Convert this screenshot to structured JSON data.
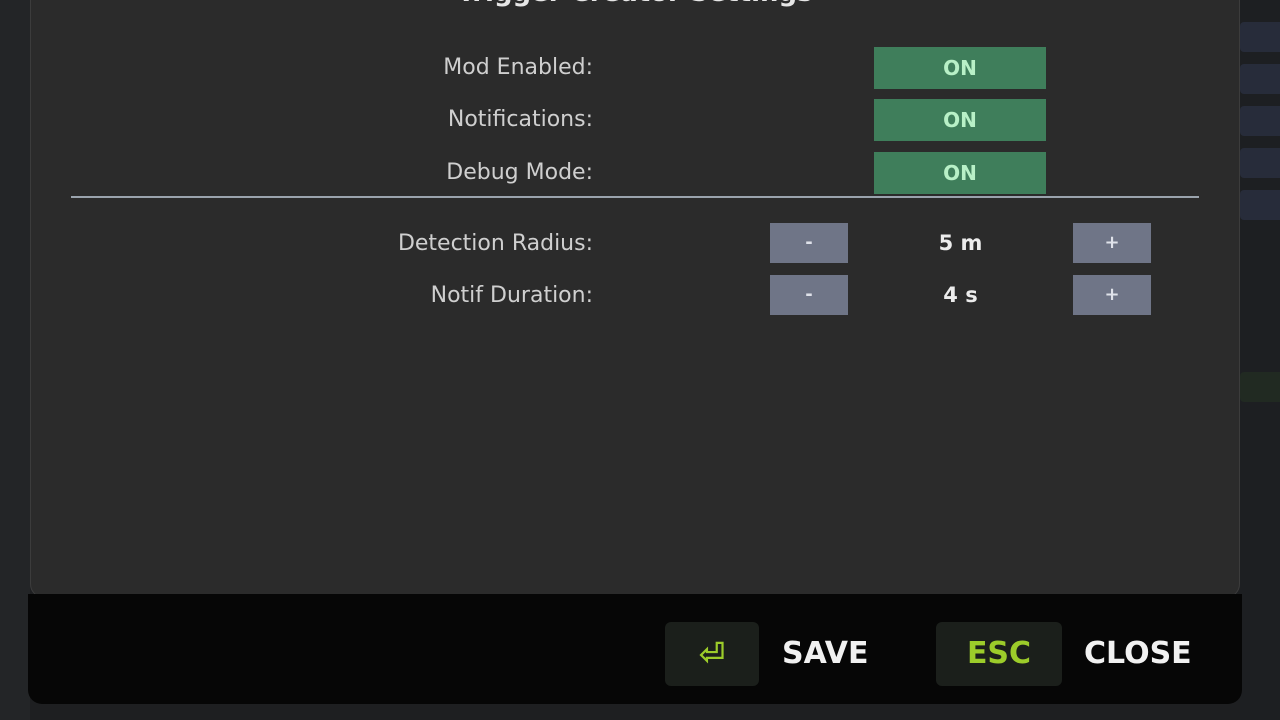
{
  "modal": {
    "title": "Trigger Creator Settings"
  },
  "toggles": [
    {
      "label": "Mod Enabled:",
      "value": "ON"
    },
    {
      "label": "Notifications:",
      "value": "ON"
    },
    {
      "label": "Debug Mode:",
      "value": "ON"
    }
  ],
  "steppers": [
    {
      "label": "Detection Radius:",
      "minus": "-",
      "value": "5 m",
      "plus": "+"
    },
    {
      "label": "Notif Duration:",
      "minus": "-",
      "value": "4 s",
      "plus": "+"
    }
  ],
  "footer": {
    "save_key": "⏎",
    "save_label": "SAVE",
    "close_key": "ESC",
    "close_label": "CLOSE"
  },
  "colors": {
    "toggle_on_bg": "#3f7e5b",
    "toggle_on_text": "#b8f0c7",
    "stepper_bg": "#6f7587",
    "key_accent": "#9ccc2a"
  }
}
